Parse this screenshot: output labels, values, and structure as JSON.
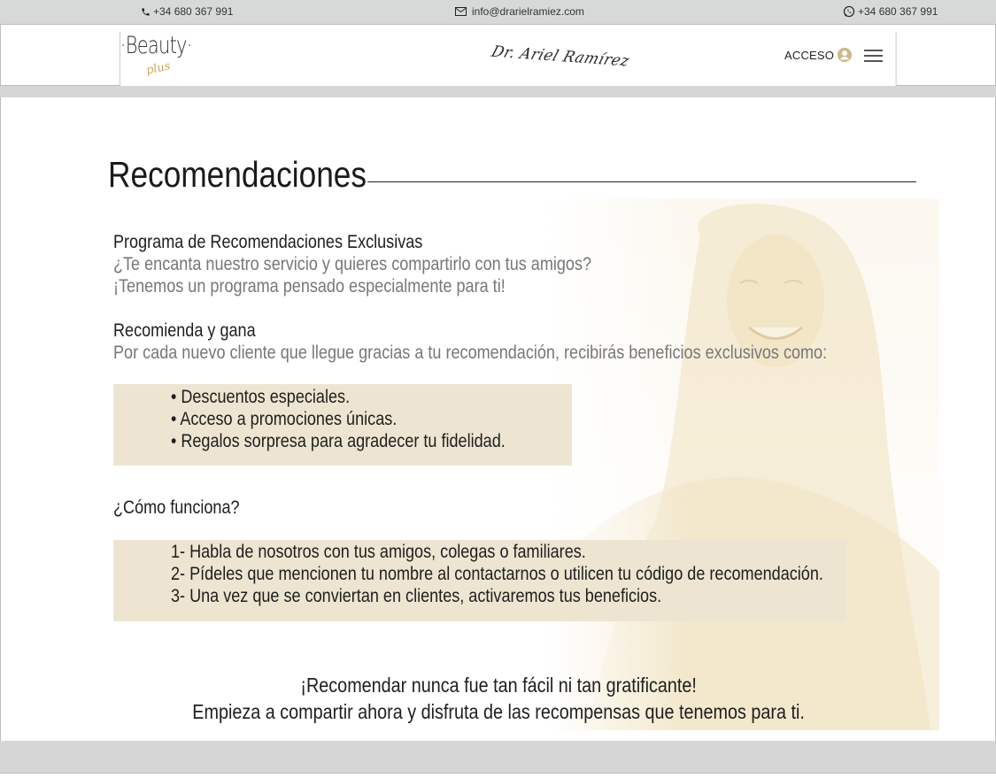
{
  "topbar": {
    "phone": "+34 680 367 991",
    "email": "info@drarielramiez.com",
    "whatsapp": "+34 680 367 991"
  },
  "header": {
    "logo_main": "·Beauty·",
    "logo_script": "plus",
    "signature": "Dr. Ariel Ramírez",
    "acceso_label": "ACCESO"
  },
  "content": {
    "title": "Recomendaciones",
    "program_heading": "Programa de Recomendaciones Exclusivas",
    "program_line1": "¿Te encanta nuestro servicio y quieres compartirlo con tus amigos?",
    "program_line2": " ¡Tenemos un programa pensado especialmente para ti!",
    "earn_heading": "Recomienda y gana",
    "earn_line": "Por cada nuevo cliente que llegue gracias a tu recomendación, recibirás beneficios exclusivos como:",
    "benefits": [
      "• Descuentos especiales.",
      "• Acceso a promociones únicas.",
      "• Regalos sorpresa para agradecer tu fidelidad."
    ],
    "how_heading": "¿Cómo funciona?",
    "steps": [
      "1- Habla de nosotros con tus amigos, colegas o familiares.",
      "2- Pídeles que mencionen tu nombre al contactarnos o utilicen tu código de recomendación.",
      "3- Una vez que se conviertan en clientes, activaremos tus beneficios."
    ],
    "closing_line1": "¡Recomendar nunca fue tan fácil ni tan gratificante!",
    "closing_line2": "Empieza a compartir ahora y disfruta de las recompensas que tenemos para ti."
  },
  "colors": {
    "highlight_box": "#ede5d1",
    "accent_gold": "#c9a85a",
    "topbar_bg": "#d7d9d8"
  }
}
